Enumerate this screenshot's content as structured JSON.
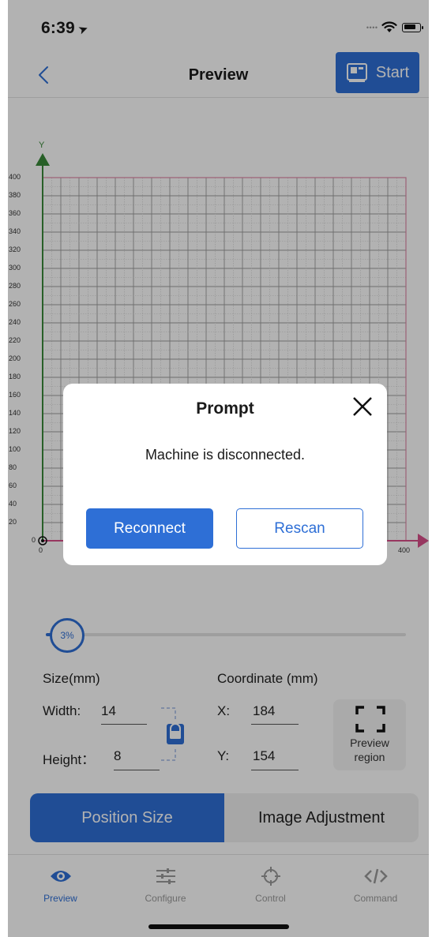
{
  "status_bar": {
    "time": "6:39",
    "location_glyph": "➤"
  },
  "nav": {
    "title": "Preview",
    "start_label": "Start"
  },
  "grid": {
    "y_axis_name": "Y",
    "y_ticks": [
      "400",
      "380",
      "360",
      "340",
      "320",
      "300",
      "280",
      "260",
      "240",
      "220",
      "200",
      "180",
      "160",
      "140",
      "120",
      "100",
      "80",
      "60",
      "40",
      "20",
      "0"
    ],
    "x_start": "0",
    "x_end": "400"
  },
  "zoom": {
    "value": "3%",
    "fraction": 0.03
  },
  "size": {
    "heading": "Size(mm)",
    "width_label": "Width:",
    "width_value": "14",
    "height_label": "Height：",
    "height_value": "8"
  },
  "coordinate": {
    "heading": "Coordinate (mm)",
    "x_label": "X:",
    "x_value": "184",
    "y_label": "Y:",
    "y_value": "154"
  },
  "preview_region": {
    "line1": "Preview",
    "line2": "region"
  },
  "segments": {
    "left": "Position Size",
    "right": "Image Adjustment"
  },
  "tabs": [
    {
      "label": "Preview",
      "icon": "eye-icon"
    },
    {
      "label": "Configure",
      "icon": "sliders-icon"
    },
    {
      "label": "Control",
      "icon": "crosshair-icon"
    },
    {
      "label": "Command",
      "icon": "code-icon"
    }
  ],
  "dialog": {
    "title": "Prompt",
    "message": "Machine is disconnected.",
    "reconnect_label": "Reconnect",
    "rescan_label": "Rescan"
  },
  "colors": {
    "accent": "#2e6fd6",
    "y_axis": "#3a8a3a",
    "x_axis": "#d94f8a",
    "grid_border": "#e08aa8"
  }
}
